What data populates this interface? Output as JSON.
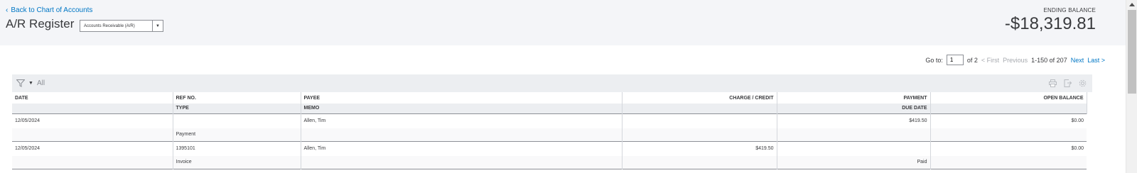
{
  "header": {
    "back_link": "Back to Chart of Accounts",
    "title": "A/R Register",
    "account_select": "Accounts Receivable (A/R)",
    "ending_balance_label": "ENDING BALANCE",
    "ending_balance": "-$18,319.81"
  },
  "pager": {
    "goto_label": "Go to:",
    "page_value": "1",
    "of_pages": "of 2",
    "first": "< First",
    "previous": "Previous",
    "range": "1-150 of 207",
    "next": "Next",
    "last": "Last >"
  },
  "toolbar": {
    "filter_label": "All",
    "icons": [
      "print-icon",
      "export-icon",
      "settings-icon"
    ]
  },
  "table": {
    "headers_row1": [
      "DATE",
      "REF NO.",
      "PAYEE",
      "CHARGE / CREDIT",
      "PAYMENT",
      "OPEN BALANCE"
    ],
    "headers_row2": [
      "",
      "TYPE",
      "MEMO",
      "",
      "DUE DATE",
      ""
    ],
    "rows": [
      {
        "date": "12/05/2024",
        "ref": "",
        "payee": "Allen, Tim",
        "charge": "",
        "payment": "$419.50",
        "open_balance": "$0.00",
        "type": "Payment",
        "memo": "",
        "due_date": ""
      },
      {
        "date": "12/05/2024",
        "ref": "1395101",
        "payee": "Allen, Tim",
        "charge": "$419.50",
        "payment": "",
        "open_balance": "$0.00",
        "type": "Invoice",
        "memo": "",
        "due_date": "Paid"
      }
    ]
  }
}
